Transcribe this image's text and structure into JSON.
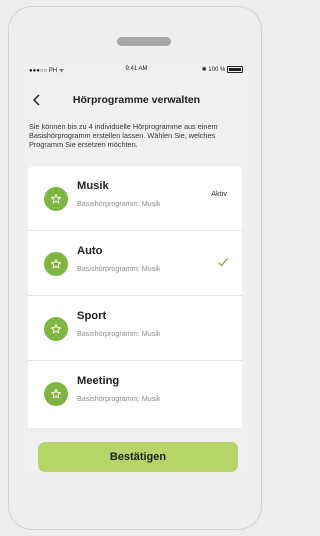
{
  "status_bar": {
    "carrier": "●●●○○ PH ᯤ",
    "time": "9:41 AM",
    "battery": "✱ 100 %"
  },
  "header": {
    "back_icon": "chevron-left-icon",
    "title": "Hörprogramme verwalten"
  },
  "description": "Sie können bis zu 4 individuelle Hörprogramme aus einem Basishörprogramm erstellen lassen. Wählen Sie, welches Programm Sie ersetzen möchten.",
  "programs": [
    {
      "name": "Musik",
      "subtitle": "Basishörprogramm: Musik",
      "status": "Aktiv",
      "selected": false
    },
    {
      "name": "Auto",
      "subtitle": "Basishörprogramm: Musik",
      "status": "",
      "selected": true
    },
    {
      "name": "Sport",
      "subtitle": "Basishörprogramm: Musik",
      "status": "",
      "selected": false
    },
    {
      "name": "Meeting",
      "subtitle": "Basishörprogramm: Musik",
      "status": "",
      "selected": false
    }
  ],
  "confirm_label": "Bestätigen",
  "colors": {
    "accent_green": "#7fb640",
    "button_green": "#b6d468",
    "background": "#f0f0f0"
  }
}
